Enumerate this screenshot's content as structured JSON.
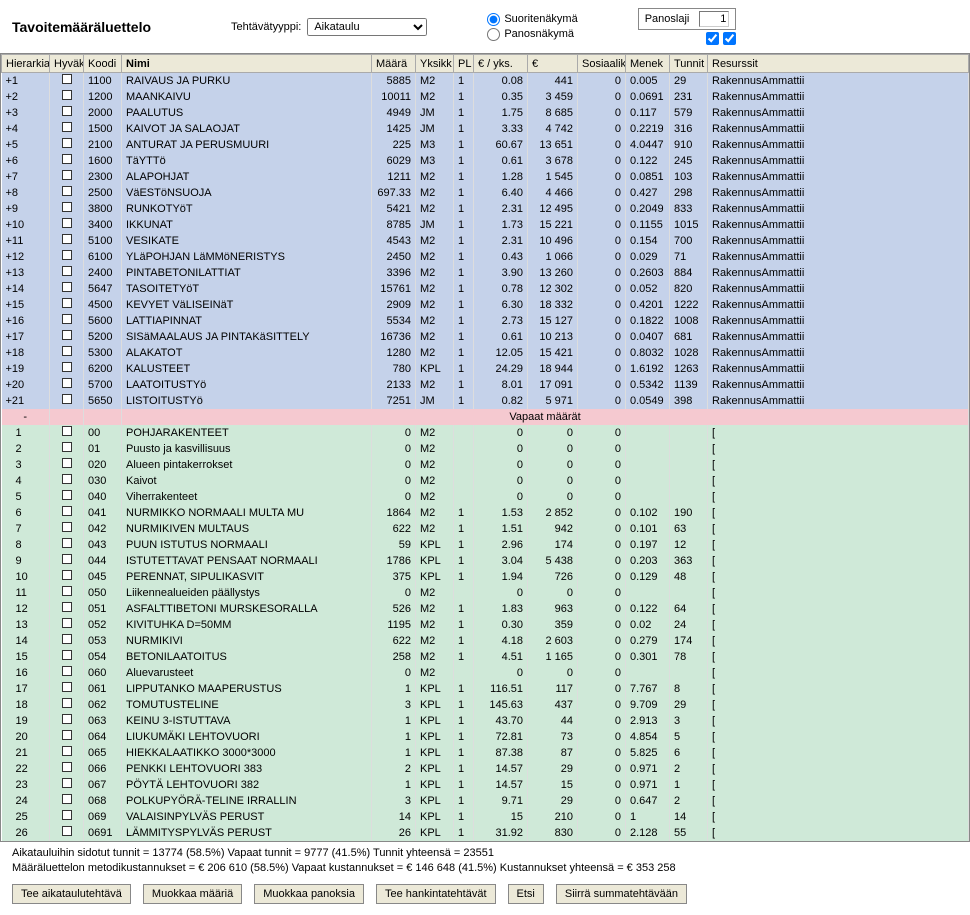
{
  "title": "Tavoitemääräluettelo",
  "task_type_label": "Tehtävätyyppi:",
  "task_type_value": "Aikataulu",
  "radio_suorite": "Suoritenäkymä",
  "radio_panos": "Panosnäkymä",
  "panoslaji_label": "Panoslaji",
  "panoslaji_value": "1",
  "columns": {
    "hierarkia": "Hierarkia",
    "hyvak": "Hyväk",
    "koodi": "Koodi",
    "nimi": "Nimi",
    "maara": "Määrä",
    "yksikko": "Yksikk",
    "pl": "PL",
    "eyks": "€ / yks.",
    "e": "€",
    "sosiaalik": "Sosiaaliku",
    "menek": "Menek",
    "tunnit": "Tunnit",
    "resurssit": "Resurssit"
  },
  "vapaat_maarat": "Vapaat määrät",
  "blue_rows": [
    {
      "h": "+1",
      "k": "1100",
      "n": "RAIVAUS JA PURKU",
      "m": "5885",
      "y": "M2",
      "pl": "1",
      "ey": "0.08",
      "e": "441",
      "s": "0",
      "me": "0.005",
      "t": "29",
      "r": "RakennusAmmattii"
    },
    {
      "h": "+2",
      "k": "1200",
      "n": "MAANKAIVU",
      "m": "10011",
      "y": "M2",
      "pl": "1",
      "ey": "0.35",
      "e": "3 459",
      "s": "0",
      "me": "0.0691",
      "t": "231",
      "r": "RakennusAmmattii"
    },
    {
      "h": "+3",
      "k": "2000",
      "n": "PAALUTUS",
      "m": "4949",
      "y": "JM",
      "pl": "1",
      "ey": "1.75",
      "e": "8 685",
      "s": "0",
      "me": "0.117",
      "t": "579",
      "r": "RakennusAmmattii"
    },
    {
      "h": "+4",
      "k": "1500",
      "n": "KAIVOT JA SALAOJAT",
      "m": "1425",
      "y": "JM",
      "pl": "1",
      "ey": "3.33",
      "e": "4 742",
      "s": "0",
      "me": "0.2219",
      "t": "316",
      "r": "RakennusAmmattii"
    },
    {
      "h": "+5",
      "k": "2100",
      "n": "ANTURAT JA PERUSMUURI",
      "m": "225",
      "y": "M3",
      "pl": "1",
      "ey": "60.67",
      "e": "13 651",
      "s": "0",
      "me": "4.0447",
      "t": "910",
      "r": "RakennusAmmattii"
    },
    {
      "h": "+6",
      "k": "1600",
      "n": "TäYTTö",
      "m": "6029",
      "y": "M3",
      "pl": "1",
      "ey": "0.61",
      "e": "3 678",
      "s": "0",
      "me": "0.122",
      "t": "245",
      "r": "RakennusAmmattii"
    },
    {
      "h": "+7",
      "k": "2300",
      "n": "ALAPOHJAT",
      "m": "1211",
      "y": "M2",
      "pl": "1",
      "ey": "1.28",
      "e": "1 545",
      "s": "0",
      "me": "0.0851",
      "t": "103",
      "r": "RakennusAmmattii"
    },
    {
      "h": "+8",
      "k": "2500",
      "n": "VäESTöNSUOJA",
      "m": "697.33",
      "y": "M2",
      "pl": "1",
      "ey": "6.40",
      "e": "4 466",
      "s": "0",
      "me": "0.427",
      "t": "298",
      "r": "RakennusAmmattii"
    },
    {
      "h": "+9",
      "k": "3800",
      "n": "RUNKOTYöT",
      "m": "5421",
      "y": "M2",
      "pl": "1",
      "ey": "2.31",
      "e": "12 495",
      "s": "0",
      "me": "0.2049",
      "t": "833",
      "r": "RakennusAmmattii"
    },
    {
      "h": "+10",
      "k": "3400",
      "n": "IKKUNAT",
      "m": "8785",
      "y": "JM",
      "pl": "1",
      "ey": "1.73",
      "e": "15 221",
      "s": "0",
      "me": "0.1155",
      "t": "1015",
      "r": "RakennusAmmattii"
    },
    {
      "h": "+11",
      "k": "5100",
      "n": "VESIKATE",
      "m": "4543",
      "y": "M2",
      "pl": "1",
      "ey": "2.31",
      "e": "10 496",
      "s": "0",
      "me": "0.154",
      "t": "700",
      "r": "RakennusAmmattii"
    },
    {
      "h": "+12",
      "k": "6100",
      "n": "YLäPOHJAN LäMMöNERISTYS",
      "m": "2450",
      "y": "M2",
      "pl": "1",
      "ey": "0.43",
      "e": "1 066",
      "s": "0",
      "me": "0.029",
      "t": "71",
      "r": "RakennusAmmattii"
    },
    {
      "h": "+13",
      "k": "2400",
      "n": "PINTABETONILATTIAT",
      "m": "3396",
      "y": "M2",
      "pl": "1",
      "ey": "3.90",
      "e": "13 260",
      "s": "0",
      "me": "0.2603",
      "t": "884",
      "r": "RakennusAmmattii"
    },
    {
      "h": "+14",
      "k": "5647",
      "n": "TASOITETYöT",
      "m": "15761",
      "y": "M2",
      "pl": "1",
      "ey": "0.78",
      "e": "12 302",
      "s": "0",
      "me": "0.052",
      "t": "820",
      "r": "RakennusAmmattii"
    },
    {
      "h": "+15",
      "k": "4500",
      "n": "KEVYET VäLISEINäT",
      "m": "2909",
      "y": "M2",
      "pl": "1",
      "ey": "6.30",
      "e": "18 332",
      "s": "0",
      "me": "0.4201",
      "t": "1222",
      "r": "RakennusAmmattii"
    },
    {
      "h": "+16",
      "k": "5600",
      "n": "LATTIAPINNAT",
      "m": "5534",
      "y": "M2",
      "pl": "1",
      "ey": "2.73",
      "e": "15 127",
      "s": "0",
      "me": "0.1822",
      "t": "1008",
      "r": "RakennusAmmattii"
    },
    {
      "h": "+17",
      "k": "5200",
      "n": "SISäMAALAUS JA PINTAKäSITTELY",
      "m": "16736",
      "y": "M2",
      "pl": "1",
      "ey": "0.61",
      "e": "10 213",
      "s": "0",
      "me": "0.0407",
      "t": "681",
      "r": "RakennusAmmattii"
    },
    {
      "h": "+18",
      "k": "5300",
      "n": "ALAKATOT",
      "m": "1280",
      "y": "M2",
      "pl": "1",
      "ey": "12.05",
      "e": "15 421",
      "s": "0",
      "me": "0.8032",
      "t": "1028",
      "r": "RakennusAmmattii"
    },
    {
      "h": "+19",
      "k": "6200",
      "n": "KALUSTEET",
      "m": "780",
      "y": "KPL",
      "pl": "1",
      "ey": "24.29",
      "e": "18 944",
      "s": "0",
      "me": "1.6192",
      "t": "1263",
      "r": "RakennusAmmattii"
    },
    {
      "h": "+20",
      "k": "5700",
      "n": "LAATOITUSTYö",
      "m": "2133",
      "y": "M2",
      "pl": "1",
      "ey": "8.01",
      "e": "17 091",
      "s": "0",
      "me": "0.5342",
      "t": "1139",
      "r": "RakennusAmmattii"
    },
    {
      "h": "+21",
      "k": "5650",
      "n": "LISTOITUSTYö",
      "m": "7251",
      "y": "JM",
      "pl": "1",
      "ey": "0.82",
      "e": "5 971",
      "s": "0",
      "me": "0.0549",
      "t": "398",
      "r": "RakennusAmmattii"
    }
  ],
  "green_rows": [
    {
      "h": "1",
      "k": "00",
      "n": "POHJARAKENTEET",
      "m": "0",
      "y": "M2",
      "pl": "",
      "ey": "0",
      "e": "0",
      "s": "0",
      "me": "",
      "t": "",
      "r": "["
    },
    {
      "h": "2",
      "k": "01",
      "n": "Puusto ja kasvillisuus",
      "m": "0",
      "y": "M2",
      "pl": "",
      "ey": "0",
      "e": "0",
      "s": "0",
      "me": "",
      "t": "",
      "r": "["
    },
    {
      "h": "3",
      "k": "020",
      "n": "Alueen pintakerrokset",
      "m": "0",
      "y": "M2",
      "pl": "",
      "ey": "0",
      "e": "0",
      "s": "0",
      "me": "",
      "t": "",
      "r": "["
    },
    {
      "h": "4",
      "k": "030",
      "n": "Kaivot",
      "m": "0",
      "y": "M2",
      "pl": "",
      "ey": "0",
      "e": "0",
      "s": "0",
      "me": "",
      "t": "",
      "r": "["
    },
    {
      "h": "5",
      "k": "040",
      "n": "Viherrakenteet",
      "m": "0",
      "y": "M2",
      "pl": "",
      "ey": "0",
      "e": "0",
      "s": "0",
      "me": "",
      "t": "",
      "r": "["
    },
    {
      "h": "6",
      "k": "041",
      "n": "NURMIKKO NORMAALI    MULTA MU",
      "m": "1864",
      "y": "M2",
      "pl": "1",
      "ey": "1.53",
      "e": "2 852",
      "s": "0",
      "me": "0.102",
      "t": "190",
      "r": "["
    },
    {
      "h": "7",
      "k": "042",
      "n": "NURMIKIVEN MULTAUS",
      "m": "622",
      "y": "M2",
      "pl": "1",
      "ey": "1.51",
      "e": "942",
      "s": "0",
      "me": "0.101",
      "t": "63",
      "r": "["
    },
    {
      "h": "8",
      "k": "043",
      "n": "PUUN ISTUTUS NORMAALI",
      "m": "59",
      "y": "KPL",
      "pl": "1",
      "ey": "2.96",
      "e": "174",
      "s": "0",
      "me": "0.197",
      "t": "12",
      "r": "["
    },
    {
      "h": "9",
      "k": "044",
      "n": "ISTUTETTAVAT PENSAAT  NORMAALI",
      "m": "1786",
      "y": "KPL",
      "pl": "1",
      "ey": "3.04",
      "e": "5 438",
      "s": "0",
      "me": "0.203",
      "t": "363",
      "r": "["
    },
    {
      "h": "10",
      "k": "045",
      "n": "PERENNAT, SIPULIKASVIT",
      "m": "375",
      "y": "KPL",
      "pl": "1",
      "ey": "1.94",
      "e": "726",
      "s": "0",
      "me": "0.129",
      "t": "48",
      "r": "["
    },
    {
      "h": "11",
      "k": "050",
      "n": "Liikennealueiden päällystys",
      "m": "0",
      "y": "M2",
      "pl": "",
      "ey": "0",
      "e": "0",
      "s": "0",
      "me": "",
      "t": "",
      "r": "["
    },
    {
      "h": "12",
      "k": "051",
      "n": "ASFALTTIBETONI MURSKESORALLA",
      "m": "526",
      "y": "M2",
      "pl": "1",
      "ey": "1.83",
      "e": "963",
      "s": "0",
      "me": "0.122",
      "t": "64",
      "r": "["
    },
    {
      "h": "13",
      "k": "052",
      "n": "KIVITUHKA    D=50MM",
      "m": "1195",
      "y": "M2",
      "pl": "1",
      "ey": "0.30",
      "e": "359",
      "s": "0",
      "me": "0.02",
      "t": "24",
      "r": "["
    },
    {
      "h": "14",
      "k": "053",
      "n": "NURMIKIVI",
      "m": "622",
      "y": "M2",
      "pl": "1",
      "ey": "4.18",
      "e": "2 603",
      "s": "0",
      "me": "0.279",
      "t": "174",
      "r": "["
    },
    {
      "h": "15",
      "k": "054",
      "n": "BETONILAATOITUS",
      "m": "258",
      "y": "M2",
      "pl": "1",
      "ey": "4.51",
      "e": "1 165",
      "s": "0",
      "me": "0.301",
      "t": "78",
      "r": "["
    },
    {
      "h": "16",
      "k": "060",
      "n": "Aluevarusteet",
      "m": "0",
      "y": "M2",
      "pl": "",
      "ey": "0",
      "e": "0",
      "s": "0",
      "me": "",
      "t": "",
      "r": "["
    },
    {
      "h": "17",
      "k": "061",
      "n": "LIPPUTANKO MAAPERUSTUS",
      "m": "1",
      "y": "KPL",
      "pl": "1",
      "ey": "116.51",
      "e": "117",
      "s": "0",
      "me": "7.767",
      "t": "8",
      "r": "["
    },
    {
      "h": "18",
      "k": "062",
      "n": "TOMUTUSTELINE",
      "m": "3",
      "y": "KPL",
      "pl": "1",
      "ey": "145.63",
      "e": "437",
      "s": "0",
      "me": "9.709",
      "t": "29",
      "r": "["
    },
    {
      "h": "19",
      "k": "063",
      "n": "KEINU 3-ISTUTTAVA",
      "m": "1",
      "y": "KPL",
      "pl": "1",
      "ey": "43.70",
      "e": "44",
      "s": "0",
      "me": "2.913",
      "t": "3",
      "r": "["
    },
    {
      "h": "20",
      "k": "064",
      "n": "LIUKUMÄKI LEHTOVUORI",
      "m": "1",
      "y": "KPL",
      "pl": "1",
      "ey": "72.81",
      "e": "73",
      "s": "0",
      "me": "4.854",
      "t": "5",
      "r": "["
    },
    {
      "h": "21",
      "k": "065",
      "n": "HIEKKALAATIKKO 3000*3000",
      "m": "1",
      "y": "KPL",
      "pl": "1",
      "ey": "87.38",
      "e": "87",
      "s": "0",
      "me": "5.825",
      "t": "6",
      "r": "["
    },
    {
      "h": "22",
      "k": "066",
      "n": "PENKKI   LEHTOVUORI 383",
      "m": "2",
      "y": "KPL",
      "pl": "1",
      "ey": "14.57",
      "e": "29",
      "s": "0",
      "me": "0.971",
      "t": "2",
      "r": "["
    },
    {
      "h": "23",
      "k": "067",
      "n": "PÖYTÄ    LEHTOVUORI 382",
      "m": "1",
      "y": "KPL",
      "pl": "1",
      "ey": "14.57",
      "e": "15",
      "s": "0",
      "me": "0.971",
      "t": "1",
      "r": "["
    },
    {
      "h": "24",
      "k": "068",
      "n": "POLKUPYÖRÄ-TELINE IRRALLIN",
      "m": "3",
      "y": "KPL",
      "pl": "1",
      "ey": "9.71",
      "e": "29",
      "s": "0",
      "me": "0.647",
      "t": "2",
      "r": "["
    },
    {
      "h": "25",
      "k": "069",
      "n": "VALAISINPYLVÄS PERUST",
      "m": "14",
      "y": "KPL",
      "pl": "1",
      "ey": "15",
      "e": "210",
      "s": "0",
      "me": "1",
      "t": "14",
      "r": "["
    },
    {
      "h": "26",
      "k": "0691",
      "n": "LÄMMITYSPYLVÄS PERUST",
      "m": "26",
      "y": "KPL",
      "pl": "1",
      "ey": "31.92",
      "e": "830",
      "s": "0",
      "me": "2.128",
      "t": "55",
      "r": "["
    }
  ],
  "stats_line1": "Aikatauluihin sidotut tunnit = 13774 (58.5%)    Vapaat tunnit = 9777 (41.5%)    Tunnit yhteensä = 23551",
  "stats_line2": "Määräluettelon metodikustannukset = € 206 610 (58.5%)    Vapaat kustannukset = € 146 648 (41.5%)    Kustannukset yhteensä = € 353 258",
  "buttons": {
    "b1": "Tee aikataulutehtävä",
    "b2": "Muokkaa määriä",
    "b3": "Muokkaa panoksia",
    "b4": "Tee hankintatehtävät",
    "b5": "Etsi",
    "b6": "Siirrä summatehtävään"
  }
}
